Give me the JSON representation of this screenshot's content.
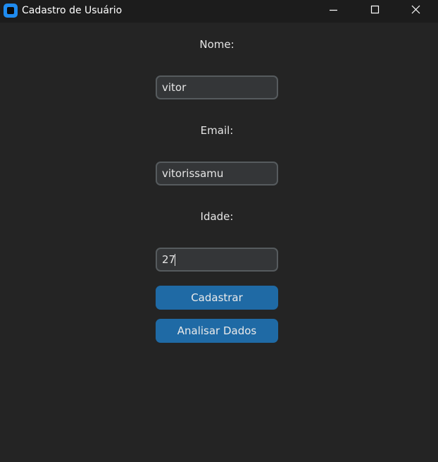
{
  "window": {
    "title": "Cadastro de Usuário",
    "icon": "app-icon",
    "controls": [
      "minimize-icon",
      "maximize-icon",
      "close-icon"
    ]
  },
  "form": {
    "nome_label": "Nome:",
    "nome_value": "vitor",
    "email_label": "Email:",
    "email_value": "vitorissamu",
    "idade_label": "Idade:",
    "idade_value": "27",
    "cadastrar_label": "Cadastrar",
    "analisar_label": "Analisar Dados"
  },
  "colors": {
    "background": "#242424",
    "titlebar": "#1c1c1c",
    "entry_bg": "#343638",
    "entry_border": "#565b5e",
    "button": "#1f6aa5",
    "app_icon": "#1f8cf0"
  }
}
